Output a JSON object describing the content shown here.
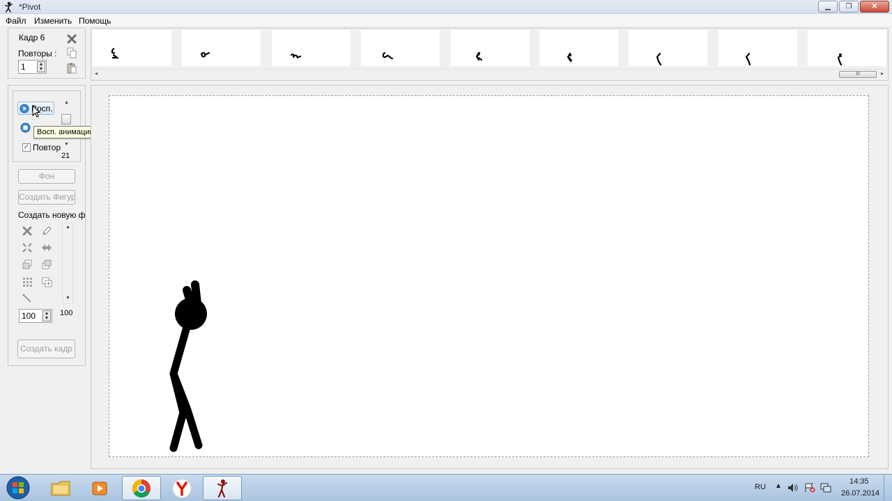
{
  "window": {
    "title": "*Pivot"
  },
  "menu": [
    "Файл",
    "Изменить",
    "Помощь"
  ],
  "frame_panel": {
    "frame_label": "Кадр 6",
    "repeats_label": "Повторы :",
    "repeats_value": "1"
  },
  "playback": {
    "play_label": "Восп.",
    "tooltip": "Восп. анимацию",
    "loop_label": "Повтор",
    "loop_checked": true,
    "speed_value": "21"
  },
  "buttons": {
    "background": "Фон",
    "create_figure": "Создать Фигуру",
    "create_frame": "Создать кадр"
  },
  "figure_tools": {
    "header": "Создать новую ф",
    "scale_value": "100",
    "scale_max": "100"
  },
  "timeline": {
    "scrollbar_grip": "III"
  },
  "taskbar": {
    "language": "RU",
    "time": "14:35",
    "date": "26.07.2014"
  }
}
